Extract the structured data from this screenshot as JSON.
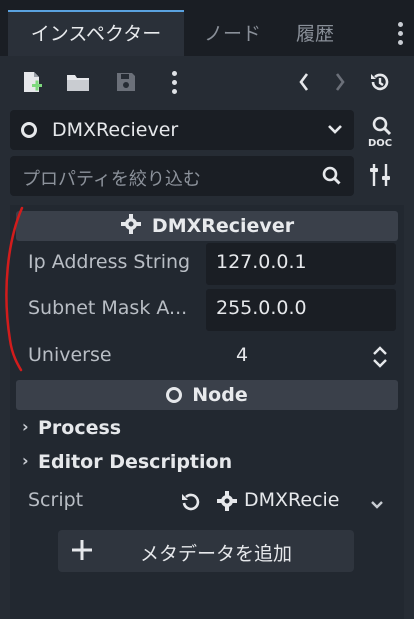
{
  "tabs": [
    {
      "label": "インスペクター",
      "active": true
    },
    {
      "label": "ノード",
      "active": false
    },
    {
      "label": "履歴",
      "active": false
    }
  ],
  "object_selector": {
    "name": "DMXReciever"
  },
  "filter": {
    "placeholder": "プロパティを絞り込む"
  },
  "script_section": {
    "title": "DMXReciever"
  },
  "properties": [
    {
      "label": "Ip Address String",
      "value": "127.0.0.1"
    },
    {
      "label": "Subnet Mask A...",
      "value": "255.0.0.0"
    },
    {
      "label": "Universe",
      "value": "4"
    }
  ],
  "node_section": {
    "title": "Node"
  },
  "categories": [
    {
      "label": "Process"
    },
    {
      "label": "Editor Description"
    }
  ],
  "script_row": {
    "label": "Script",
    "value": "DMXRecie"
  },
  "add_metadata": {
    "label": "メタデータを追加"
  },
  "colors": {
    "accent": "#5aa2e0",
    "annotation": "#d21c1c",
    "add_icon": "#7dd87d"
  }
}
